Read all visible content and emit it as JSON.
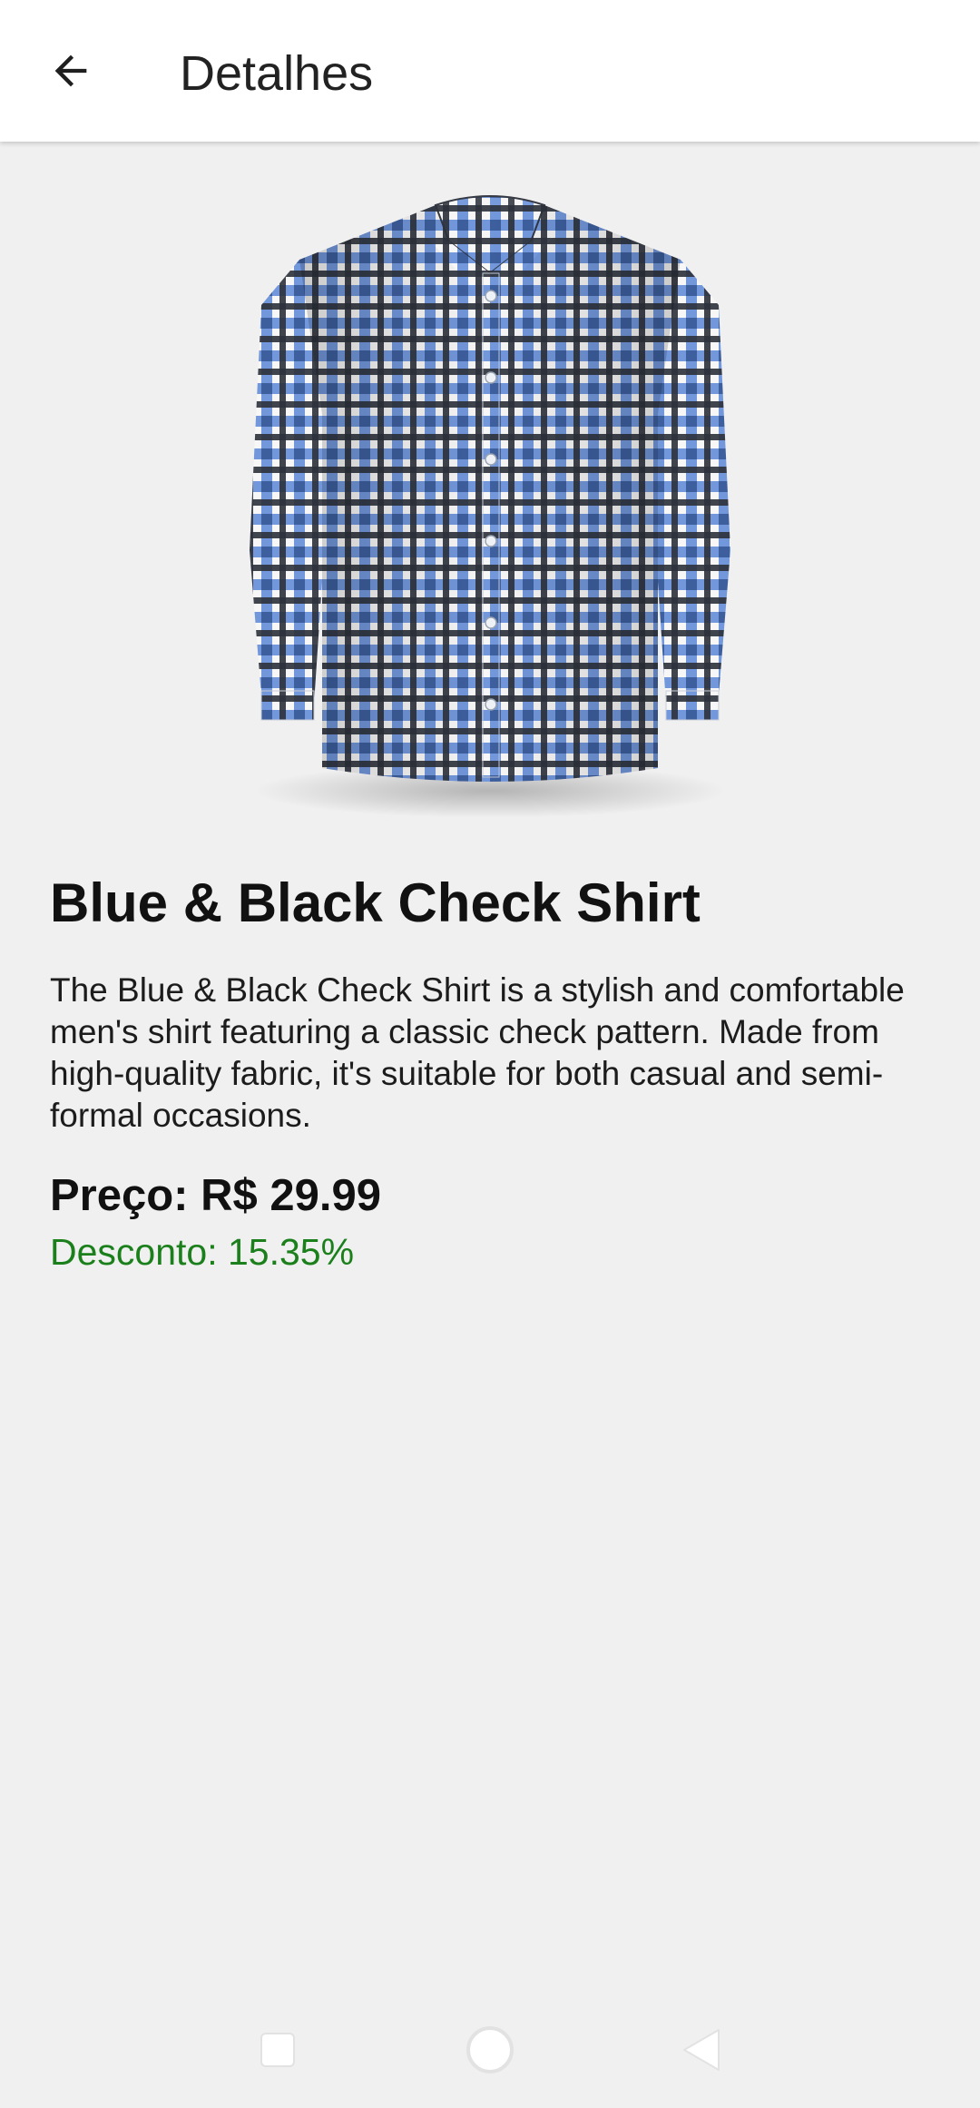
{
  "app_bar": {
    "title": "Detalhes",
    "back_icon": "arrow-left-icon"
  },
  "product": {
    "image_alt": "blue-black-check-shirt-image",
    "name": "Blue & Black Check Shirt",
    "description": "The Blue & Black Check Shirt is a stylish and comfortable men's shirt featuring a classic check pattern. Made from high-quality fabric, it's suitable for both casual and semi-formal occasions.",
    "price": "Preço: R$ 29.99",
    "discount": "Desconto: 15.35%"
  },
  "nav_bar": {
    "recents_icon": "square-icon",
    "home_icon": "circle-icon",
    "back_icon": "triangle-back-icon"
  },
  "colors": {
    "discount": "#1b7f1b",
    "background": "#f0f0f0",
    "app_bar": "#ffffff",
    "shirt_blue": "#4f7fd0",
    "shirt_dark": "#2f3440"
  }
}
